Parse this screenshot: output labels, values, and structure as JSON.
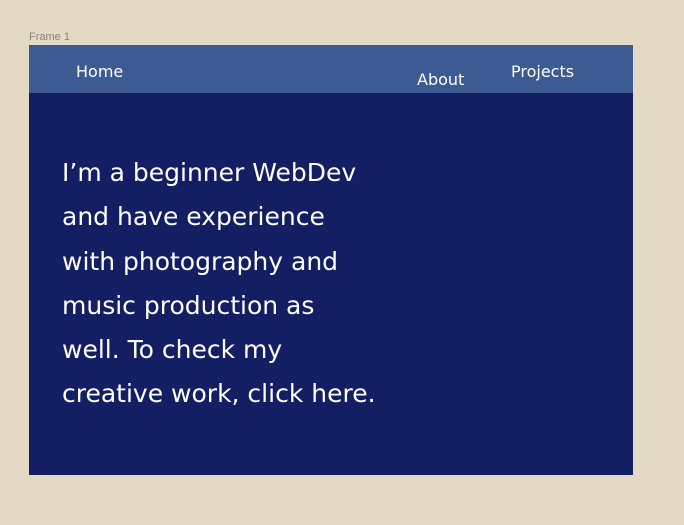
{
  "canvas": {
    "frame_label": "Frame 1"
  },
  "nav": {
    "home": "Home",
    "about": "About",
    "projects": "Projects"
  },
  "intro": {
    "lines": [
      "I’m a beginner  WebDev",
      "and have experience",
      "with photography and",
      "music production as",
      "well. To check my",
      "creative work, click here."
    ]
  },
  "colors": {
    "canvas_background": "#e3d9c5",
    "frame_background": "#131e63",
    "navbar_background": "#3b5b92",
    "text": "#ffffff"
  }
}
